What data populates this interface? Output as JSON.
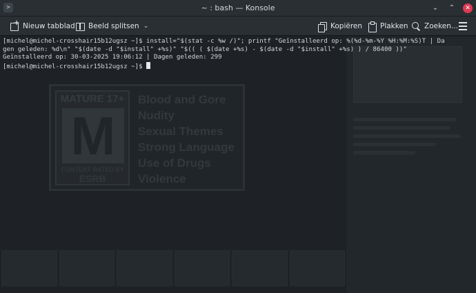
{
  "window": {
    "title": "~ : bash — Konsole",
    "app_icon_glyph": ">"
  },
  "toolbar": {
    "new_tab": "Nieuw tabblad",
    "split_view": "Beeld splitsen",
    "copy": "Kopiëren",
    "paste": "Plakken",
    "search": "Zoeken..."
  },
  "terminal": {
    "lines": [
      "[michel@michel-crosshair15b12ugsz ~]$ install=\"$(stat -c %w /)\"; printf \"Geïnstalleerd op: %(%d-%m-%Y %H:%M:%S)T | Da",
      "gen geleden: %d\\n\" \"$(date -d \"$install\" +%s)\" \"$(( ( $(date +%s) - $(date -d \"$install\" +%s) ) / 86400 ))\"",
      "Geïnstalleerd op: 30-03-2025 19:06:12 | Dagen geleden: 299",
      "[michel@michel-crosshair15b12ugsz ~]$ "
    ]
  },
  "background_art": {
    "rating_header": "MATURE 17+",
    "rating_letter": "M",
    "rating_footer_small": "CONTENT RATED BY",
    "rating_footer_big": "ESRB",
    "descriptors": [
      "Blood and Gore",
      "Nudity",
      "Sexual Themes",
      "Strong Language",
      "Use of Drugs",
      "Violence"
    ]
  },
  "colors": {
    "terminal_bg": "#1e2226",
    "chrome_bg": "#2a2f34",
    "close_button": "#dc3b53",
    "text": "#d5d8da"
  }
}
